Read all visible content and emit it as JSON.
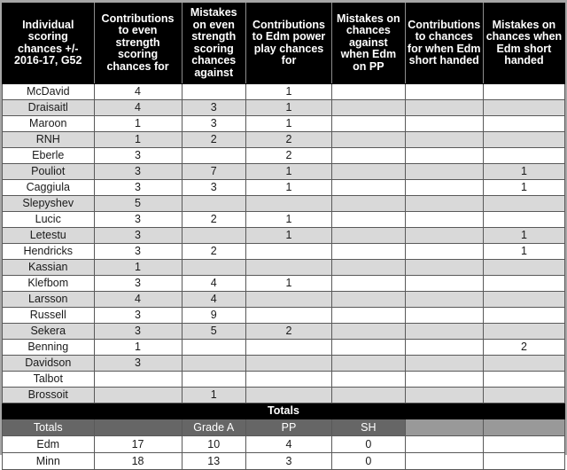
{
  "table": {
    "columns": [
      {
        "key": "name",
        "label": "Individual scoring chances +/- 2016-17, G52",
        "width": "16.3%"
      },
      {
        "key": "es_for",
        "label": "Contributions to even strength scoring chances for",
        "width": "15.6%"
      },
      {
        "key": "es_against",
        "label": "Mistakes on even strength scoring chances against",
        "width": "11.4%"
      },
      {
        "key": "pp_for",
        "label": "Contributions to Edm power play chances for",
        "width": "15.3%"
      },
      {
        "key": "pp_against",
        "label": "Mistakes on chances against when Edm on PP",
        "width": "13.0%"
      },
      {
        "key": "sh_for",
        "label": "Contributions to chances for when Edm short handed",
        "width": "13.9%"
      },
      {
        "key": "sh_against",
        "label": "Mistakes on chances when Edm short handed",
        "width": "14.5%"
      }
    ],
    "rows": [
      {
        "name": "McDavid",
        "es_for": "4",
        "es_against": "",
        "pp_for": "1",
        "pp_against": "",
        "sh_for": "",
        "sh_against": "",
        "shaded": false
      },
      {
        "name": "Draisaitl",
        "es_for": "4",
        "es_against": "3",
        "pp_for": "1",
        "pp_against": "",
        "sh_for": "",
        "sh_against": "",
        "shaded": true
      },
      {
        "name": "Maroon",
        "es_for": "1",
        "es_against": "3",
        "pp_for": "1",
        "pp_against": "",
        "sh_for": "",
        "sh_against": "",
        "shaded": false
      },
      {
        "name": "RNH",
        "es_for": "1",
        "es_against": "2",
        "pp_for": "2",
        "pp_against": "",
        "sh_for": "",
        "sh_against": "",
        "shaded": true
      },
      {
        "name": "Eberle",
        "es_for": "3",
        "es_against": "",
        "pp_for": "2",
        "pp_against": "",
        "sh_for": "",
        "sh_against": "",
        "shaded": false
      },
      {
        "name": "Pouliot",
        "es_for": "3",
        "es_against": "7",
        "pp_for": "1",
        "pp_against": "",
        "sh_for": "",
        "sh_against": "1",
        "shaded": true
      },
      {
        "name": "Caggiula",
        "es_for": "3",
        "es_against": "3",
        "pp_for": "1",
        "pp_against": "",
        "sh_for": "",
        "sh_against": "1",
        "shaded": false
      },
      {
        "name": "Slepyshev",
        "es_for": "5",
        "es_against": "",
        "pp_for": "",
        "pp_against": "",
        "sh_for": "",
        "sh_against": "",
        "shaded": true
      },
      {
        "name": "Lucic",
        "es_for": "3",
        "es_against": "2",
        "pp_for": "1",
        "pp_against": "",
        "sh_for": "",
        "sh_against": "",
        "shaded": false
      },
      {
        "name": "Letestu",
        "es_for": "3",
        "es_against": "",
        "pp_for": "1",
        "pp_against": "",
        "sh_for": "",
        "sh_against": "1",
        "shaded": true
      },
      {
        "name": "Hendricks",
        "es_for": "3",
        "es_against": "2",
        "pp_for": "",
        "pp_against": "",
        "sh_for": "",
        "sh_against": "1",
        "shaded": false
      },
      {
        "name": "Kassian",
        "es_for": "1",
        "es_against": "",
        "pp_for": "",
        "pp_against": "",
        "sh_for": "",
        "sh_against": "",
        "shaded": true
      },
      {
        "name": "Klefbom",
        "es_for": "3",
        "es_against": "4",
        "pp_for": "1",
        "pp_against": "",
        "sh_for": "",
        "sh_against": "",
        "shaded": false
      },
      {
        "name": "Larsson",
        "es_for": "4",
        "es_against": "4",
        "pp_for": "",
        "pp_against": "",
        "sh_for": "",
        "sh_against": "",
        "shaded": true
      },
      {
        "name": "Russell",
        "es_for": "3",
        "es_against": "9",
        "pp_for": "",
        "pp_against": "",
        "sh_for": "",
        "sh_against": "",
        "shaded": false
      },
      {
        "name": "Sekera",
        "es_for": "3",
        "es_against": "5",
        "pp_for": "2",
        "pp_against": "",
        "sh_for": "",
        "sh_against": "",
        "shaded": true
      },
      {
        "name": "Benning",
        "es_for": "1",
        "es_against": "",
        "pp_for": "",
        "pp_against": "",
        "sh_for": "",
        "sh_against": "2",
        "shaded": false
      },
      {
        "name": "Davidson",
        "es_for": "3",
        "es_against": "",
        "pp_for": "",
        "pp_against": "",
        "sh_for": "",
        "sh_against": "",
        "shaded": true
      },
      {
        "name": "Talbot",
        "es_for": "",
        "es_against": "",
        "pp_for": "",
        "pp_against": "",
        "sh_for": "",
        "sh_against": "",
        "shaded": false
      },
      {
        "name": "Brossoit",
        "es_for": "",
        "es_against": "1",
        "pp_for": "",
        "pp_against": "",
        "sh_for": "",
        "sh_against": "",
        "shaded": true
      }
    ]
  },
  "totals": {
    "banner_label": "Totals",
    "header": [
      "Totals",
      "",
      "Grade A",
      "PP",
      "SH",
      "",
      ""
    ],
    "rows": [
      {
        "team": "Edm",
        "c1": "17",
        "c2": "10",
        "c3": "4",
        "c4": "0",
        "c5": "",
        "c6": ""
      },
      {
        "team": "Minn",
        "c1": "18",
        "c2": "13",
        "c3": "3",
        "c4": "0",
        "c5": "",
        "c6": ""
      }
    ]
  },
  "colors": {
    "header_bg": "#000000",
    "header_text": "#ffffff",
    "row_shaded": "#d9d9d9",
    "row_plain": "#ffffff",
    "totals_head_bg": "#666666",
    "totals_head_blank_bg": "#999999",
    "grid_line": "#595959",
    "sheet_border": "#a6a6a6"
  }
}
